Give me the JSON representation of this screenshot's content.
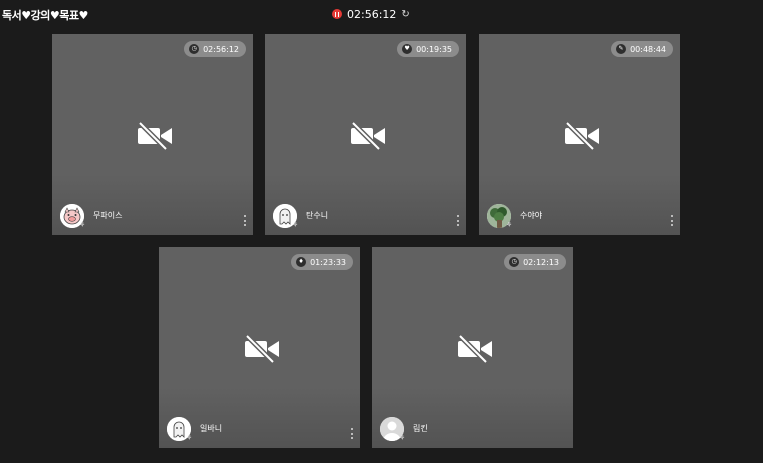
{
  "header": {
    "room_title": "독서♥강의♥목표♥",
    "elapsed_time": "02:56:12",
    "status_color": "#e53935"
  },
  "participants": [
    {
      "name": "무파이스",
      "time": "02:56:12",
      "status_icon": "clock-icon",
      "avatar": "pig-avatar"
    },
    {
      "name": "탄수니",
      "time": "00:19:35",
      "status_icon": "heart-icon",
      "avatar": "ghost-avatar"
    },
    {
      "name": "수야야",
      "time": "00:48:44",
      "status_icon": "pencil-icon",
      "avatar": "plant-avatar"
    },
    {
      "name": "일바니",
      "time": "01:23:33",
      "status_icon": "fire-icon",
      "avatar": "ghost-avatar"
    },
    {
      "name": "림킨",
      "time": "02:12:13",
      "status_icon": "clock-icon",
      "avatar": "default-person-avatar"
    }
  ]
}
